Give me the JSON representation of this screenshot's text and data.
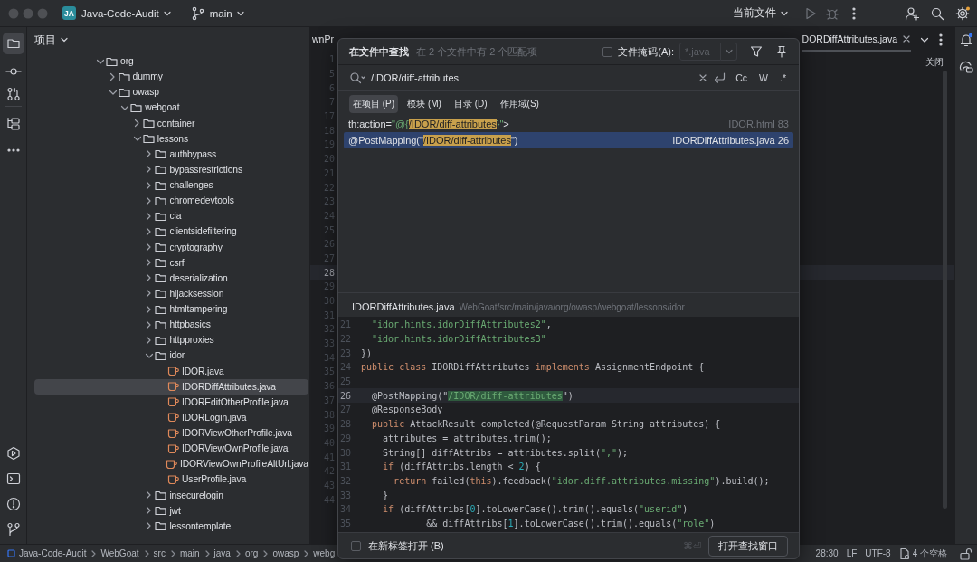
{
  "window": {
    "project_badge": "JA",
    "project": "Java-Code-Audit",
    "branch": "main",
    "run_config": "当前文件"
  },
  "project": {
    "title": "项目",
    "tree": [
      {
        "label": "org",
        "kind": "folder",
        "expanded": true,
        "selected": false,
        "children": [
          {
            "label": "dummy",
            "kind": "folder",
            "expanded": false,
            "selected": false
          },
          {
            "label": "owasp",
            "kind": "folder",
            "expanded": true,
            "selected": false,
            "children": [
              {
                "label": "webgoat",
                "kind": "folder",
                "expanded": true,
                "selected": false,
                "children": [
                  {
                    "label": "container",
                    "kind": "folder",
                    "expanded": false,
                    "selected": false
                  },
                  {
                    "label": "lessons",
                    "kind": "folder",
                    "expanded": true,
                    "selected": false,
                    "children": [
                      {
                        "label": "authbypass",
                        "kind": "folder",
                        "expanded": false,
                        "selected": false
                      },
                      {
                        "label": "bypassrestrictions",
                        "kind": "folder",
                        "expanded": false,
                        "selected": false
                      },
                      {
                        "label": "challenges",
                        "kind": "folder",
                        "expanded": false,
                        "selected": false
                      },
                      {
                        "label": "chromedevtools",
                        "kind": "folder",
                        "expanded": false,
                        "selected": false
                      },
                      {
                        "label": "cia",
                        "kind": "folder",
                        "expanded": false,
                        "selected": false
                      },
                      {
                        "label": "clientsidefiltering",
                        "kind": "folder",
                        "expanded": false,
                        "selected": false
                      },
                      {
                        "label": "cryptography",
                        "kind": "folder",
                        "expanded": false,
                        "selected": false
                      },
                      {
                        "label": "csrf",
                        "kind": "folder",
                        "expanded": false,
                        "selected": false
                      },
                      {
                        "label": "deserialization",
                        "kind": "folder",
                        "expanded": false,
                        "selected": false
                      },
                      {
                        "label": "hijacksession",
                        "kind": "folder",
                        "expanded": false,
                        "selected": false
                      },
                      {
                        "label": "htmltampering",
                        "kind": "folder",
                        "expanded": false,
                        "selected": false
                      },
                      {
                        "label": "httpbasics",
                        "kind": "folder",
                        "expanded": false,
                        "selected": false
                      },
                      {
                        "label": "httpproxies",
                        "kind": "folder",
                        "expanded": false,
                        "selected": false
                      },
                      {
                        "label": "idor",
                        "kind": "folder",
                        "expanded": true,
                        "selected": false,
                        "children": [
                          {
                            "label": "IDOR.java",
                            "kind": "file",
                            "selected": false
                          },
                          {
                            "label": "IDORDiffAttributes.java",
                            "kind": "file",
                            "selected": true
                          },
                          {
                            "label": "IDOREditOtherProfile.java",
                            "kind": "file",
                            "selected": false
                          },
                          {
                            "label": "IDORLogin.java",
                            "kind": "file",
                            "selected": false
                          },
                          {
                            "label": "IDORViewOtherProfile.java",
                            "kind": "file",
                            "selected": false
                          },
                          {
                            "label": "IDORViewOwnProfile.java",
                            "kind": "file",
                            "selected": false
                          },
                          {
                            "label": "IDORViewOwnProfileAltUrl.java",
                            "kind": "file",
                            "selected": false
                          },
                          {
                            "label": "UserProfile.java",
                            "kind": "file",
                            "selected": false
                          }
                        ]
                      },
                      {
                        "label": "insecurelogin",
                        "kind": "folder",
                        "expanded": false,
                        "selected": false
                      },
                      {
                        "label": "jwt",
                        "kind": "folder",
                        "expanded": false,
                        "selected": false
                      },
                      {
                        "label": "lessontemplate",
                        "kind": "folder",
                        "expanded": false,
                        "selected": false
                      }
                    ]
                  }
                ]
              }
            ]
          }
        ]
      }
    ]
  },
  "editor": {
    "tabs": [
      {
        "label": "wnPr",
        "selected": false
      },
      {
        "label": "DORDiffAttributes.java",
        "selected": true
      }
    ],
    "close_hint": "关闭",
    "gutter": [
      {
        "number": "1",
        "current": false
      },
      {
        "number": "5",
        "current": false
      },
      {
        "number": "6",
        "current": false
      },
      {
        "number": "7",
        "current": false
      },
      {
        "number": "17",
        "current": false
      },
      {
        "number": "18",
        "current": false
      },
      {
        "number": "19",
        "current": false
      },
      {
        "number": "20",
        "current": false
      },
      {
        "number": "21",
        "current": false
      },
      {
        "number": "22",
        "current": false
      },
      {
        "number": "23",
        "current": false
      },
      {
        "number": "24",
        "current": false
      },
      {
        "number": "25",
        "current": false
      },
      {
        "number": "26",
        "current": false
      },
      {
        "number": "27",
        "current": false
      },
      {
        "number": "28",
        "current": true
      },
      {
        "number": "29",
        "current": false
      },
      {
        "number": "30",
        "current": false
      },
      {
        "number": "31",
        "current": false
      },
      {
        "number": "32",
        "current": false
      },
      {
        "number": "33",
        "current": false
      },
      {
        "number": "34",
        "current": false
      },
      {
        "number": "35",
        "current": false
      },
      {
        "number": "36",
        "current": false
      },
      {
        "number": "37",
        "current": false
      },
      {
        "number": "38",
        "current": false
      },
      {
        "number": "39",
        "current": false
      },
      {
        "number": "40",
        "current": false
      },
      {
        "number": "41",
        "current": false
      },
      {
        "number": "42",
        "current": false
      },
      {
        "number": "43",
        "current": false
      },
      {
        "number": "44",
        "current": false
      }
    ]
  },
  "find_dialog": {
    "title": "在文件中查找",
    "summary": "在 2 个文件中有 2 个匹配项",
    "file_mask": {
      "label": "文件掩码(A):",
      "checked": false,
      "value": "*.java"
    },
    "query": "/IDOR/diff-attributes",
    "options": [
      "Cc",
      "W",
      ".*"
    ],
    "scopes": [
      {
        "label": "在项目 (P)",
        "selected": true
      },
      {
        "label": "模块 (M)",
        "selected": false
      },
      {
        "label": "目录 (D)",
        "selected": false
      },
      {
        "label": "作用域(S)",
        "selected": false
      }
    ],
    "results": [
      {
        "selected": false,
        "location": "IDOR.html 83",
        "segments": [
          {
            "kind": "plain",
            "text": "th:action="
          },
          {
            "kind": "string",
            "text": "\"@{"
          },
          {
            "kind": "match",
            "text": "/IDOR/diff-attributes"
          },
          {
            "kind": "string",
            "text": "}\""
          },
          {
            "kind": "plain",
            "text": ">"
          }
        ]
      },
      {
        "selected": true,
        "location": "IDORDiffAttributes.java 26",
        "segments": [
          {
            "kind": "plain",
            "text": "@PostMapping(\""
          },
          {
            "kind": "match",
            "text": "/IDOR/diff-attributes"
          },
          {
            "kind": "plain",
            "text": "\")"
          }
        ]
      }
    ],
    "preview": {
      "file": "IDORDiffAttributes.java",
      "path": "WebGoat/src/main/java/org/owasp/webgoat/lessons/idor",
      "lines": [
        {
          "number": "21",
          "current": false,
          "segments": [
            {
              "kind": "string",
              "text": "  \"idor.hints.idorDiffAttributes2\""
            },
            {
              "kind": "plain",
              "text": ","
            }
          ]
        },
        {
          "number": "22",
          "current": false,
          "segments": [
            {
              "kind": "string",
              "text": "  \"idor.hints.idorDiffAttributes3\""
            }
          ]
        },
        {
          "number": "23",
          "current": false,
          "segments": [
            {
              "kind": "plain",
              "text": "})"
            }
          ]
        },
        {
          "number": "24",
          "current": false,
          "segments": [
            {
              "kind": "keyword",
              "text": "public class"
            },
            {
              "kind": "plain",
              "text": " IDORDiffAttributes "
            },
            {
              "kind": "keyword",
              "text": "implements"
            },
            {
              "kind": "plain",
              "text": " AssignmentEndpoint {"
            }
          ]
        },
        {
          "number": "25",
          "current": false
        },
        {
          "number": "26",
          "current": true,
          "segments": [
            {
              "kind": "plain",
              "text": "  @PostMapping(\""
            },
            {
              "kind": "match",
              "text": "/IDOR/diff-attributes"
            },
            {
              "kind": "plain",
              "text": "\")"
            }
          ]
        },
        {
          "number": "27",
          "current": false,
          "segments": [
            {
              "kind": "plain",
              "text": "  @ResponseBody"
            }
          ]
        },
        {
          "number": "28",
          "current": false,
          "segments": [
            {
              "kind": "keyword",
              "text": "  public"
            },
            {
              "kind": "plain",
              "text": " AttackResult completed(@RequestParam String attributes) {"
            }
          ]
        },
        {
          "number": "29",
          "current": false,
          "segments": [
            {
              "kind": "plain",
              "text": "    attributes = attributes.trim();"
            }
          ]
        },
        {
          "number": "30",
          "current": false,
          "segments": [
            {
              "kind": "plain",
              "text": "    String[] diffAttribs = attributes.split("
            },
            {
              "kind": "string",
              "text": "\",\""
            },
            {
              "kind": "plain",
              "text": ");"
            }
          ]
        },
        {
          "number": "31",
          "current": false,
          "segments": [
            {
              "kind": "keyword",
              "text": "    if"
            },
            {
              "kind": "plain",
              "text": " (diffAttribs.length < "
            },
            {
              "kind": "number",
              "text": "2"
            },
            {
              "kind": "plain",
              "text": ") {"
            }
          ]
        },
        {
          "number": "32",
          "current": false,
          "segments": [
            {
              "kind": "keyword",
              "text": "      return"
            },
            {
              "kind": "plain",
              "text": " failed("
            },
            {
              "kind": "keyword",
              "text": "this"
            },
            {
              "kind": "plain",
              "text": ").feedback("
            },
            {
              "kind": "string",
              "text": "\"idor.diff.attributes.missing\""
            },
            {
              "kind": "plain",
              "text": ").build();"
            }
          ]
        },
        {
          "number": "33",
          "current": false,
          "segments": [
            {
              "kind": "plain",
              "text": "    }"
            }
          ]
        },
        {
          "number": "34",
          "current": false,
          "segments": [
            {
              "kind": "keyword",
              "text": "    if"
            },
            {
              "kind": "plain",
              "text": " (diffAttribs["
            },
            {
              "kind": "number",
              "text": "0"
            },
            {
              "kind": "plain",
              "text": "].toLowerCase().trim().equals("
            },
            {
              "kind": "string",
              "text": "\"userid\""
            },
            {
              "kind": "plain",
              "text": ")"
            }
          ]
        },
        {
          "number": "35",
          "current": false,
          "segments": [
            {
              "kind": "plain",
              "text": "            && diffAttribs["
            },
            {
              "kind": "number",
              "text": "1"
            },
            {
              "kind": "plain",
              "text": "].toLowerCase().trim().equals("
            },
            {
              "kind": "string",
              "text": "\"role\""
            },
            {
              "kind": "plain",
              "text": ")"
            }
          ]
        }
      ]
    },
    "footer": {
      "new_tab": {
        "label": "在新标签打开 (B)",
        "checked": false
      },
      "shortcut": "⌘⏎",
      "button": "打开查找窗口"
    }
  },
  "status_bar": {
    "breadcrumbs": [
      "Java-Code-Audit",
      "WebGoat",
      "src",
      "main",
      "java",
      "org",
      "owasp",
      "webg"
    ],
    "position": "28:30",
    "line_separator": "LF",
    "encoding": "UTF-8",
    "indent": "4 个空格"
  }
}
